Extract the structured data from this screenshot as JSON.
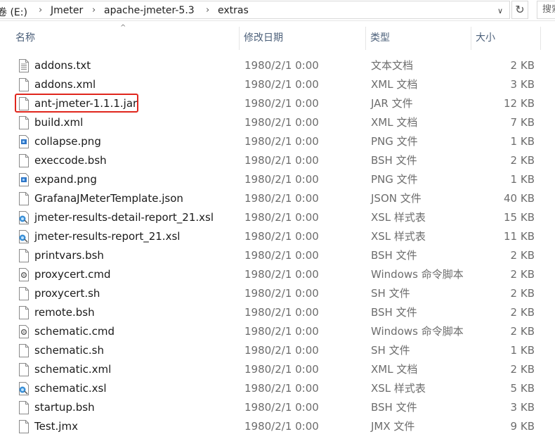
{
  "address": {
    "crumbs": [
      "卷 (E:)",
      "Jmeter",
      "apache-jmeter-5.3",
      "extras"
    ],
    "separator": "›",
    "dropdown_glyph": "∨",
    "refresh_glyph": "↻",
    "search_placeholder": "搜索"
  },
  "columns": {
    "name": "名称",
    "date": "修改日期",
    "type": "类型",
    "size": "大小",
    "sort_indicator": "^"
  },
  "files": [
    {
      "name": "addons.txt",
      "date": "1980/2/1 0:00",
      "type": "文本文档",
      "size": "2 KB",
      "icon": "text-file-icon"
    },
    {
      "name": "addons.xml",
      "date": "1980/2/1 0:00",
      "type": "XML 文档",
      "size": "3 KB",
      "icon": "blank-file-icon"
    },
    {
      "name": "ant-jmeter-1.1.1.jar",
      "date": "1980/2/1 0:00",
      "type": "JAR 文件",
      "size": "12 KB",
      "icon": "blank-file-icon",
      "highlighted": true
    },
    {
      "name": "build.xml",
      "date": "1980/2/1 0:00",
      "type": "XML 文档",
      "size": "7 KB",
      "icon": "blank-file-icon"
    },
    {
      "name": "collapse.png",
      "date": "1980/2/1 0:00",
      "type": "PNG 文件",
      "size": "1 KB",
      "icon": "image-file-icon"
    },
    {
      "name": "execcode.bsh",
      "date": "1980/2/1 0:00",
      "type": "BSH 文件",
      "size": "2 KB",
      "icon": "blank-file-icon"
    },
    {
      "name": "expand.png",
      "date": "1980/2/1 0:00",
      "type": "PNG 文件",
      "size": "1 KB",
      "icon": "image-file-icon"
    },
    {
      "name": "GrafanaJMeterTemplate.json",
      "date": "1980/2/1 0:00",
      "type": "JSON 文件",
      "size": "40 KB",
      "icon": "blank-file-icon"
    },
    {
      "name": "jmeter-results-detail-report_21.xsl",
      "date": "1980/2/1 0:00",
      "type": "XSL 样式表",
      "size": "15 KB",
      "icon": "xsl-file-icon"
    },
    {
      "name": "jmeter-results-report_21.xsl",
      "date": "1980/2/1 0:00",
      "type": "XSL 样式表",
      "size": "11 KB",
      "icon": "xsl-file-icon"
    },
    {
      "name": "printvars.bsh",
      "date": "1980/2/1 0:00",
      "type": "BSH 文件",
      "size": "2 KB",
      "icon": "blank-file-icon"
    },
    {
      "name": "proxycert.cmd",
      "date": "1980/2/1 0:00",
      "type": "Windows 命令脚本",
      "size": "2 KB",
      "icon": "cmd-file-icon"
    },
    {
      "name": "proxycert.sh",
      "date": "1980/2/1 0:00",
      "type": "SH 文件",
      "size": "2 KB",
      "icon": "blank-file-icon"
    },
    {
      "name": "remote.bsh",
      "date": "1980/2/1 0:00",
      "type": "BSH 文件",
      "size": "2 KB",
      "icon": "blank-file-icon"
    },
    {
      "name": "schematic.cmd",
      "date": "1980/2/1 0:00",
      "type": "Windows 命令脚本",
      "size": "2 KB",
      "icon": "cmd-file-icon"
    },
    {
      "name": "schematic.sh",
      "date": "1980/2/1 0:00",
      "type": "SH 文件",
      "size": "1 KB",
      "icon": "blank-file-icon"
    },
    {
      "name": "schematic.xml",
      "date": "1980/2/1 0:00",
      "type": "XML 文档",
      "size": "2 KB",
      "icon": "blank-file-icon"
    },
    {
      "name": "schematic.xsl",
      "date": "1980/2/1 0:00",
      "type": "XSL 样式表",
      "size": "5 KB",
      "icon": "xsl-file-icon"
    },
    {
      "name": "startup.bsh",
      "date": "1980/2/1 0:00",
      "type": "BSH 文件",
      "size": "3 KB",
      "icon": "blank-file-icon"
    },
    {
      "name": "Test.jmx",
      "date": "1980/2/1 0:00",
      "type": "JMX 文件",
      "size": "9 KB",
      "icon": "blank-file-icon"
    }
  ],
  "colors": {
    "highlight_border": "#e0261d",
    "header_text": "#4c607a",
    "secondary_text": "#6d6d6d"
  }
}
